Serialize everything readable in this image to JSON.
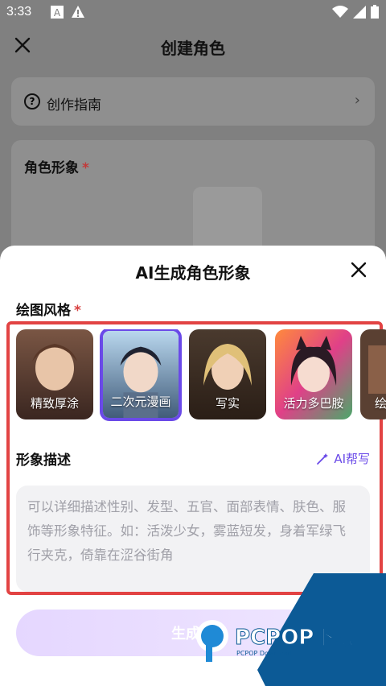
{
  "status": {
    "time": "3:33",
    "icons": [
      "a-icon",
      "warning-icon",
      "wifi-icon",
      "signal-icon",
      "battery-icon"
    ]
  },
  "bg": {
    "title": "创建角色",
    "guide_label": "创作指南",
    "role_label": "角色形象"
  },
  "sheet": {
    "title": "AI生成角色形象",
    "style_label": "绘图风格",
    "styles": [
      {
        "name": "精致厚涂"
      },
      {
        "name": "二次元漫画"
      },
      {
        "name": "写实"
      },
      {
        "name": "活力多巴胺"
      },
      {
        "name": "绘"
      }
    ],
    "selected_style": "二次元漫画",
    "desc_title": "形象描述",
    "ai_help": "AI帮写",
    "desc_placeholder": "可以详细描述性别、发型、五官、面部表情、肤色、服饰等形象特征。如：活泼少女，雾蓝短发，身着军绿飞行夹克，倚靠在涩谷街角",
    "generate_label": "生成图",
    "watermark": "PCPOP下载",
    "watermark_sub": "PCPOP Download"
  },
  "colors": {
    "accent": "#6a4ae8",
    "highlight": "#e24343",
    "watermark": "#0c5a96"
  }
}
